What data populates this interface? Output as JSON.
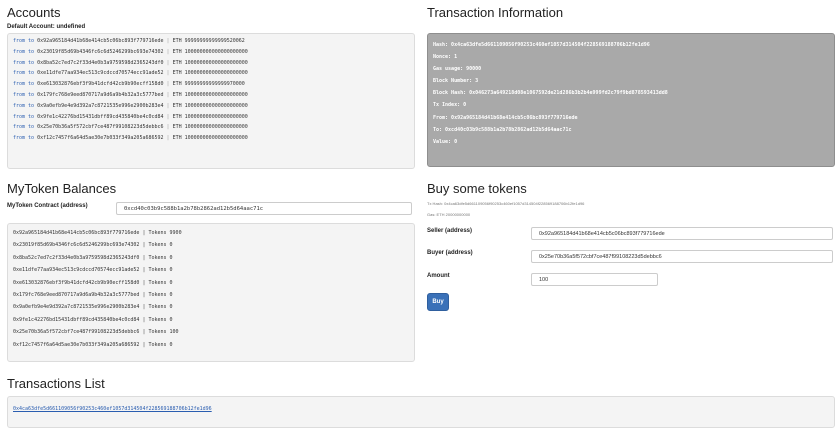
{
  "accounts": {
    "title": "Accounts",
    "default_account_label": "Default Account: undefined",
    "rows": [
      {
        "prefix": "from to",
        "addr": "0x92a965184d41b68e414cb5c06bc893f779716ede",
        "eth": "ETH 99999999999999520062"
      },
      {
        "prefix": "from to",
        "addr": "0x23019f85d69b4346fc6c6d5246299bc693e74302",
        "eth": "ETH 100000000000000000000"
      },
      {
        "prefix": "from to",
        "addr": "0x8ba52c7ed7c2f33d4e0b3a9759598d2365243df0",
        "eth": "ETH 100000000000000000000"
      },
      {
        "prefix": "from to",
        "addr": "0xe11dfe77aa934ec513c9cdccd70574ecc91ade52",
        "eth": "ETH 100000000000000000000"
      },
      {
        "prefix": "from to",
        "addr": "0xe613032876ebf3f9b41dcfd42cb9b90ecff158d0",
        "eth": "ETH 99999999999999970000"
      },
      {
        "prefix": "from to",
        "addr": "0x179fc768e9eed870717a9d6a9b4b32a3c5777bed",
        "eth": "ETH 100000000000000000000"
      },
      {
        "prefix": "from to",
        "addr": "0x9a0efb9e4e9d392a7c8721535e996e2900b283e4",
        "eth": "ETH 100000000000000000000"
      },
      {
        "prefix": "from to",
        "addr": "0x9fe1c42276bd15431dbff89cd435840be4c0cd84",
        "eth": "ETH 100000000000000000000"
      },
      {
        "prefix": "from to",
        "addr": "0x25e70b36a5f572cbf7ce487f99108223d5debbc6",
        "eth": "ETH 100000000000000000000"
      },
      {
        "prefix": "from to",
        "addr": "0xf12c7457f6a64d5ae30e7b033f349a205a686592",
        "eth": "ETH 100000000000000000000"
      }
    ]
  },
  "transaction_info": {
    "title": "Transaction Information",
    "rows": [
      "Hash: 0x4ca63dfe5d661109056f90253c460ef1057d314504f228569188706b12fe1d96",
      "Nonce: 1",
      "Gas usage: 90000",
      "Block Number: 3",
      "Block Hash: 0x046273a649218d08e1067592de21d286b3b2b4e999fd2c79f9bd878593413dd8",
      "Tx Index: 0",
      "From: 0x92a965184d41b68e414cb5c06bc893f779716ede",
      "To: 0xcd40c03b9c588b1a2b78b2862ad12b5d64aac71c",
      "Value: 0"
    ]
  },
  "mytoken": {
    "title": "MyToken Balances",
    "contract_label": "MyToken Contract (address)",
    "contract_value": "0xcd40c03b9c588b1a2b78b2862ad12b5d64aac71c",
    "rows": [
      "0x92a965184d41b68e414cb5c06bc893f779716ede | Tokens 9900",
      "0x23019f85d69b4346fc6c6d5246299bc693e74302 | Tokens 0",
      "0x8ba52c7ed7c2f33d4e0b3a9759598d2365243df0 | Tokens 0",
      "0xe11dfe77aa934ec513c9cdccd70574ecc91ade52 | Tokens 0",
      "0xe613032876ebf3f9b41dcfd42cb9b90ecff158d0 | Tokens 0",
      "0x179fc768e9eed870717a9d6a9b4b32a3c5777bed | Tokens 0",
      "0x9a0efb9e4e9d392a7c8721535e996e2900b283e4 | Tokens 0",
      "0x9fe1c42276bd15431dbff89cd435840be4c0cd84 | Tokens 0",
      "0x25e70b36a5f572cbf7ce487f99108223d5debbc6 | Tokens 100",
      "0xf12c7457f6a64d5ae30e7b033f349a205a686592 | Tokens 0"
    ]
  },
  "buy": {
    "title": "Buy some tokens",
    "tx_hash": "Tx Hash: 0x4ca63dfe5d661109056f90253c460ef1057d314504f228569188706b12fe1d96",
    "gas": "Gas: ETH 20000000000",
    "seller_label": "Seller (address)",
    "seller_value": "0x92a965184d41b68e414cb5c06bc893f779716ede",
    "buyer_label": "Buyer (address)",
    "buyer_value": "0x25e70b36a5f572cbf7ce487f99108223d5debbc6",
    "amount_label": "Amount",
    "amount_value": "100",
    "button_label": "Buy"
  },
  "transactions_list": {
    "title": "Transactions List",
    "items": [
      "0x4ca63dfe5d661109056f90253c460ef1057d314504f228569188706b12fe1d96"
    ]
  }
}
